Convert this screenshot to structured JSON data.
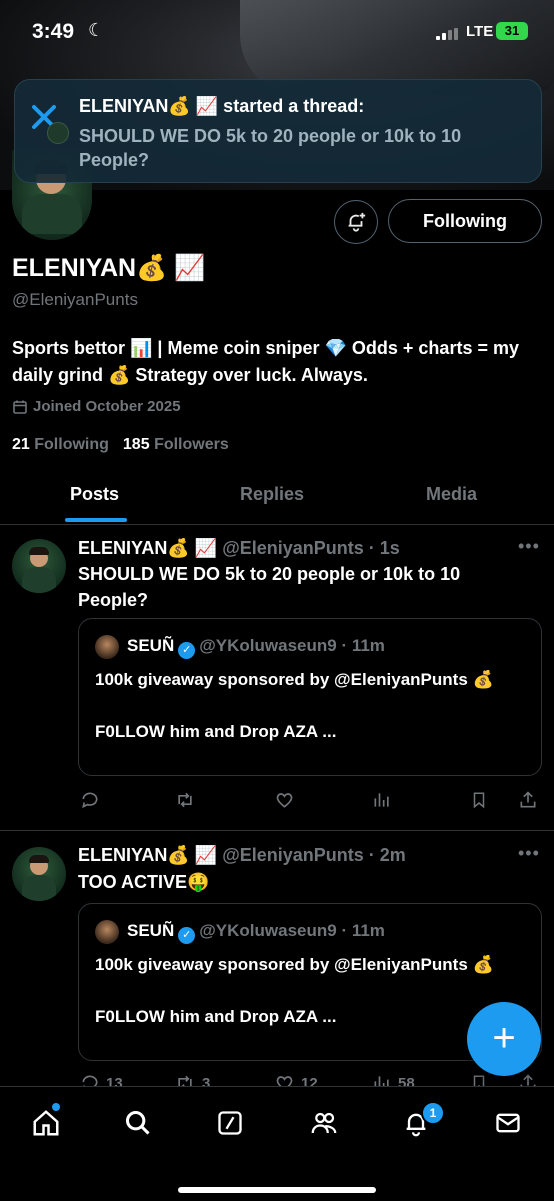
{
  "status_bar": {
    "time": "3:49",
    "network": "LTE",
    "battery": "31"
  },
  "notification": {
    "title": "ELENIYAN💰 📈 started a thread:",
    "body": "SHOULD WE DO 5k to 20 people or 10k to 10 People?"
  },
  "profile": {
    "following_label": "Following",
    "display_name": "ELENIYAN💰 📈",
    "handle": "@EleniyanPunts",
    "bio": "Sports bettor 📊 | Meme coin sniper 💎 Odds + charts = my daily grind 💰 Strategy over luck. Always.",
    "joined": "Joined October 2025",
    "following_count": "21",
    "following_text": "Following",
    "followers_count": "185",
    "followers_text": "Followers"
  },
  "tabs": [
    {
      "label": "Posts",
      "active": true
    },
    {
      "label": "Replies",
      "active": false
    },
    {
      "label": "Media",
      "active": false
    }
  ],
  "posts": [
    {
      "name": "ELENIYAN💰 📈",
      "meta": "@EleniyanPunts · 1s",
      "text": "SHOULD WE DO 5k to 20 people or 10k to 10 People?",
      "quote": {
        "name": "SEUÑ",
        "meta": "@YKoluwaseun9 · 11m",
        "text": "100k giveaway sponsored by @EleniyanPunts 💰\n\nF0LLOW him and Drop AZA ..."
      },
      "actions": {
        "reply": "",
        "repost": "",
        "like": "",
        "views": ""
      }
    },
    {
      "name": "ELENIYAN💰 📈",
      "meta": "@EleniyanPunts · 2m",
      "text": "TOO ACTIVE🤑",
      "quote": {
        "name": "SEUÑ",
        "meta": "@YKoluwaseun9 · 11m",
        "text": "100k giveaway sponsored by @EleniyanPunts 💰\n\nF0LLOW him and Drop AZA ..."
      },
      "actions": {
        "reply": "13",
        "repost": "3",
        "like": "12",
        "views": "58"
      }
    }
  ],
  "fab": {
    "label": "+"
  },
  "nav": {
    "notification_badge": "1"
  },
  "colors": {
    "accent": "#1d9bf0",
    "background": "#000000",
    "muted": "#71767b",
    "battery": "#32d74b"
  }
}
